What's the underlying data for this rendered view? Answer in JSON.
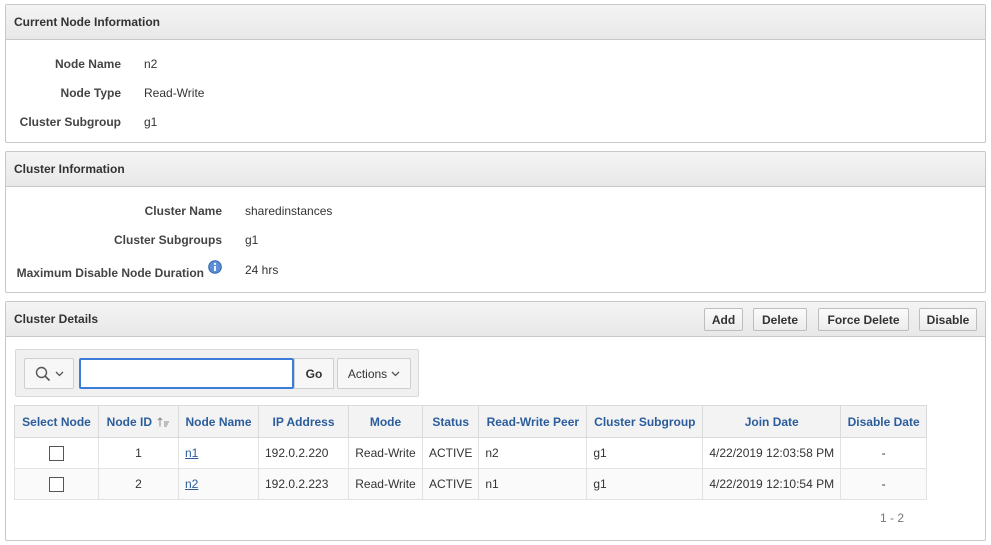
{
  "current_node": {
    "title": "Current Node Information",
    "rows": [
      {
        "label": "Node Name",
        "value": "n2"
      },
      {
        "label": "Node Type",
        "value": "Read-Write"
      },
      {
        "label": "Cluster Subgroup",
        "value": "g1"
      }
    ]
  },
  "cluster_info": {
    "title": "Cluster Information",
    "rows": [
      {
        "label": "Cluster Name",
        "value": "sharedinstances"
      },
      {
        "label": "Cluster Subgroups",
        "value": "g1"
      },
      {
        "label": "Maximum Disable Node Duration",
        "value": "24 hrs"
      }
    ],
    "info_icon": "info-icon"
  },
  "cluster_details": {
    "title": "Cluster Details",
    "buttons": {
      "add": "Add",
      "delete": "Delete",
      "force_delete": "Force Delete",
      "disable": "Disable"
    },
    "toolbar": {
      "search_icon": "search-icon",
      "search_value": "",
      "go_label": "Go",
      "actions_label": "Actions"
    },
    "columns": [
      "Select Node",
      "Node ID",
      "Node Name",
      "IP Address",
      "Mode",
      "Status",
      "Read-Write Peer",
      "Cluster Subgroup",
      "Join Date",
      "Disable Date"
    ],
    "rows": [
      {
        "node_id": "1",
        "node_name": "n1",
        "ip": "192.0.2.220",
        "mode": "Read-Write",
        "status": "ACTIVE",
        "peer": "n2",
        "subgroup": "g1",
        "join_date": "4/22/2019 12:03:58 PM",
        "disable_date": "-"
      },
      {
        "node_id": "2",
        "node_name": "n2",
        "ip": "192.0.2.223",
        "mode": "Read-Write",
        "status": "ACTIVE",
        "peer": "n1",
        "subgroup": "g1",
        "join_date": "4/22/2019 12:10:54 PM",
        "disable_date": "-"
      }
    ],
    "pagination": "1 - 2"
  },
  "colors": {
    "link": "#2b5d9c",
    "active": "#2e8b2e",
    "focus": "#3b7dd8"
  }
}
